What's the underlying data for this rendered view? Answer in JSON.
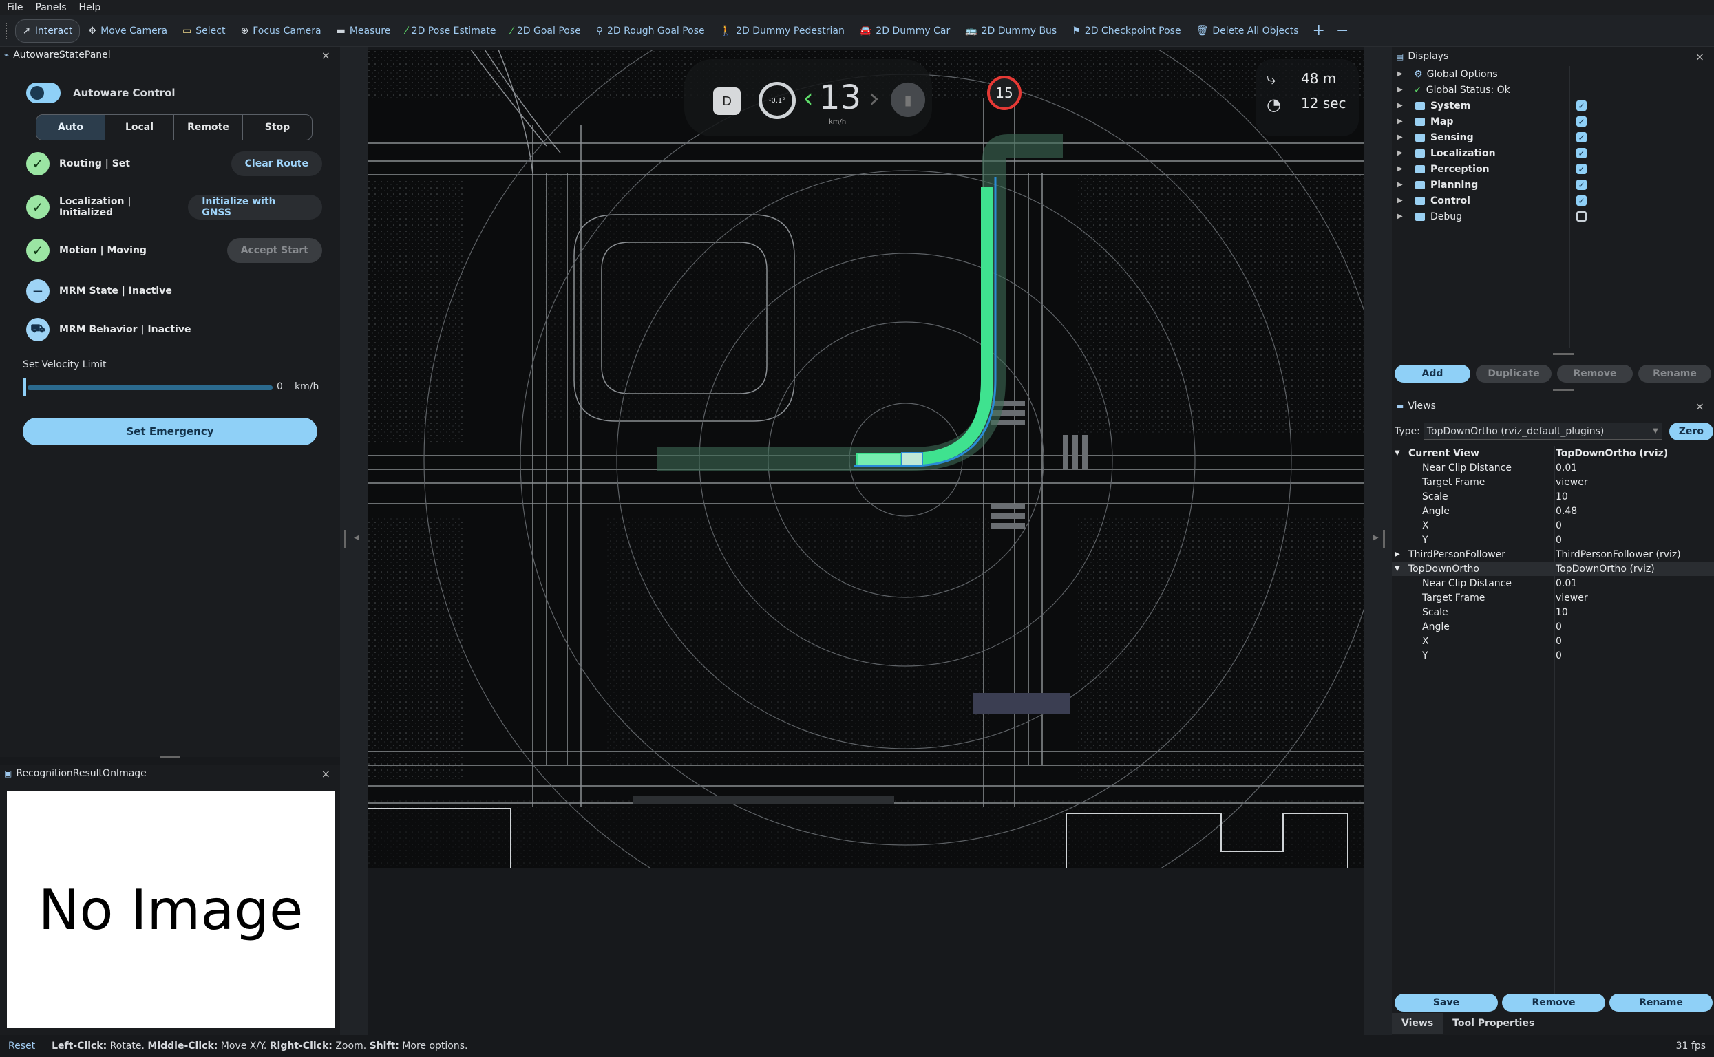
{
  "menubar": {
    "items": [
      "File",
      "Panels",
      "Help"
    ]
  },
  "toolbar": {
    "tools": [
      {
        "label": "Interact",
        "icon": "cursor-icon"
      },
      {
        "label": "Move Camera",
        "icon": "move-icon"
      },
      {
        "label": "Select",
        "icon": "select-icon"
      },
      {
        "label": "Focus Camera",
        "icon": "focus-icon"
      },
      {
        "label": "Measure",
        "icon": "ruler-icon"
      },
      {
        "label": "2D Pose Estimate",
        "icon": "pose-arrow-icon"
      },
      {
        "label": "2D Goal Pose",
        "icon": "goal-arrow-icon"
      },
      {
        "label": "2D Rough Goal Pose",
        "icon": "pin-icon"
      },
      {
        "label": "2D Dummy Pedestrian",
        "icon": "pedestrian-icon"
      },
      {
        "label": "2D Dummy Car",
        "icon": "car-icon"
      },
      {
        "label": "2D Dummy Bus",
        "icon": "bus-icon"
      },
      {
        "label": "2D Checkpoint Pose",
        "icon": "flag-icon"
      },
      {
        "label": "Delete All Objects",
        "icon": "trash-icon"
      }
    ],
    "add": "+",
    "remove": "−"
  },
  "autoware_panel": {
    "title": "AutowareStatePanel",
    "close": "×",
    "control_label": "Autoware Control",
    "modes": [
      "Auto",
      "Local",
      "Remote",
      "Stop"
    ],
    "selected_mode": "Auto",
    "routing": {
      "label": "Routing | Set",
      "button": "Clear Route"
    },
    "localization": {
      "label": "Localization | Initialized",
      "button": "Initialize with GNSS"
    },
    "motion": {
      "label": "Motion | Moving",
      "button": "Accept Start"
    },
    "mrm_state": {
      "label": "MRM State | Inactive"
    },
    "mrm_behavior": {
      "label": "MRM Behavior | Inactive"
    },
    "velocity": {
      "label": "Set Velocity Limit",
      "value": "0",
      "unit": "km/h",
      "fraction": 0.0
    },
    "emergency_button": "Set Emergency"
  },
  "recognition_panel": {
    "title": "RecognitionResultOnImage",
    "close": "×",
    "placeholder": "No Image"
  },
  "hud": {
    "gear": "D",
    "steering": "-0.1°",
    "speed": "13",
    "speed_unit": "km/h",
    "speed_limit": "15",
    "distance": "48 m",
    "time": "12 sec"
  },
  "displays": {
    "title": "Displays",
    "close": "×",
    "items": [
      {
        "label": "Global Options",
        "icon": "gear-icon",
        "checked": null,
        "bold": false
      },
      {
        "label": "Global Status: Ok",
        "icon": "check-icon",
        "checked": null,
        "bold": false
      },
      {
        "label": "System",
        "icon": "folder-icon",
        "checked": true,
        "bold": true
      },
      {
        "label": "Map",
        "icon": "folder-icon",
        "checked": true,
        "bold": true
      },
      {
        "label": "Sensing",
        "icon": "folder-icon",
        "checked": true,
        "bold": true
      },
      {
        "label": "Localization",
        "icon": "folder-icon",
        "checked": true,
        "bold": true
      },
      {
        "label": "Perception",
        "icon": "folder-icon",
        "checked": true,
        "bold": true
      },
      {
        "label": "Planning",
        "icon": "folder-icon",
        "checked": true,
        "bold": true
      },
      {
        "label": "Control",
        "icon": "folder-icon",
        "checked": true,
        "bold": true
      },
      {
        "label": "Debug",
        "icon": "folder-icon",
        "checked": false,
        "bold": false
      }
    ],
    "buttons": {
      "add": "Add",
      "duplicate": "Duplicate",
      "remove": "Remove",
      "rename": "Rename"
    }
  },
  "views": {
    "title": "Views",
    "close": "×",
    "type_label": "Type:",
    "type_value": "TopDownOrtho (rviz_default_plugins)",
    "zero_button": "Zero",
    "rows": [
      {
        "key": "Current View",
        "value": "TopDownOrtho (rviz)",
        "level": 0,
        "expanded": true,
        "bold": true
      },
      {
        "key": "Near Clip Distance",
        "value": "0.01",
        "level": 1
      },
      {
        "key": "Target Frame",
        "value": "viewer",
        "level": 1
      },
      {
        "key": "Scale",
        "value": "10",
        "level": 1
      },
      {
        "key": "Angle",
        "value": "0.48",
        "level": 1
      },
      {
        "key": "X",
        "value": "0",
        "level": 1
      },
      {
        "key": "Y",
        "value": "0",
        "level": 1
      },
      {
        "key": "ThirdPersonFollower",
        "value": "ThirdPersonFollower (rviz)",
        "level": 0,
        "expanded": false
      },
      {
        "key": "TopDownOrtho",
        "value": "TopDownOrtho (rviz)",
        "level": 0,
        "expanded": true,
        "selected": true
      },
      {
        "key": "Near Clip Distance",
        "value": "0.01",
        "level": 1
      },
      {
        "key": "Target Frame",
        "value": "viewer",
        "level": 1
      },
      {
        "key": "Scale",
        "value": "10",
        "level": 1
      },
      {
        "key": "Angle",
        "value": "0",
        "level": 1
      },
      {
        "key": "X",
        "value": "0",
        "level": 1
      },
      {
        "key": "Y",
        "value": "0",
        "level": 1
      }
    ],
    "buttons": {
      "save": "Save",
      "remove": "Remove",
      "rename": "Rename"
    },
    "tabs": [
      "Views",
      "Tool Properties"
    ]
  },
  "statusbar": {
    "reset": "Reset",
    "hint_parts": [
      {
        "b": "Left-Click:",
        "t": " Rotate. "
      },
      {
        "b": "Middle-Click:",
        "t": " Move X/Y. "
      },
      {
        "b": "Right-Click:",
        "t": " Zoom. "
      },
      {
        "b": "Shift:",
        "t": " More options."
      }
    ],
    "fps": "31 fps"
  },
  "colors": {
    "accent": "#8fd0f7",
    "path": "#3fe28f",
    "ok": "#9be5a3",
    "limit": "#e53935"
  }
}
